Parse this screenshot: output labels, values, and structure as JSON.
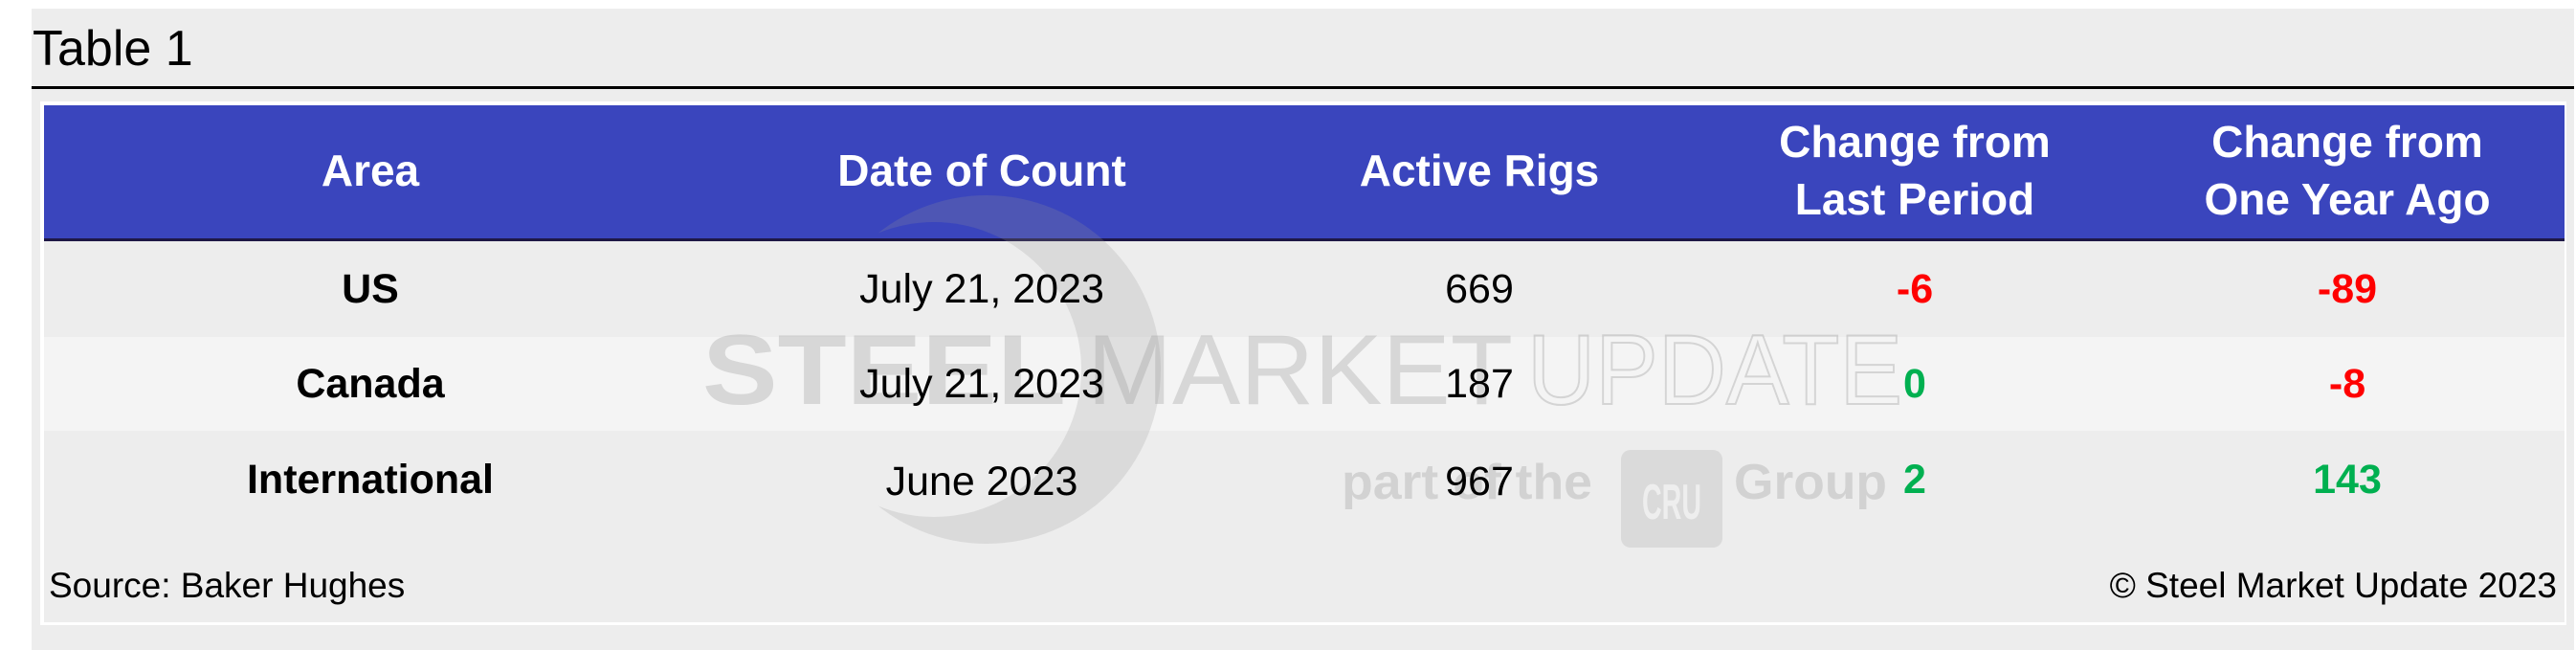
{
  "title": "Table 1",
  "table": {
    "columns": [
      "Area",
      "Date of Count",
      "Active Rigs",
      "Change from\nLast Period",
      "Change from\nOne Year Ago"
    ],
    "header": {
      "area": "Area",
      "date": "Date of Count",
      "rigs": "Active Rigs",
      "change_last_line1": "Change from",
      "change_last_line2": "Last Period",
      "change_year_line1": "Change from",
      "change_year_line2": "One Year Ago"
    },
    "rows": [
      {
        "area": "US",
        "date": "July 21, 2023",
        "rigs": "669",
        "change_last": "-6",
        "change_year": "-89"
      },
      {
        "area": "Canada",
        "date": "July 21, 2023",
        "rigs": "187",
        "change_last": "0",
        "change_year": "-8"
      },
      {
        "area": "International",
        "date": "June 2023",
        "rigs": "967",
        "change_last": "2",
        "change_year": "143"
      }
    ]
  },
  "footer": {
    "source": "Source: Baker Hughes",
    "copyright": "© Steel Market Update 2023"
  },
  "watermark": {
    "word1": "STEEL",
    "word2": "MARKET",
    "word3": "UPDATE",
    "tagline_part1": "part of the",
    "tagline_logo": "CRU",
    "tagline_part2": "Group",
    "icon": "crescent-logo-icon"
  },
  "colors": {
    "header_bg": "#3a45bd",
    "negative": "#ff0000",
    "positive": "#00b050",
    "panel_bg": "#ededed"
  }
}
